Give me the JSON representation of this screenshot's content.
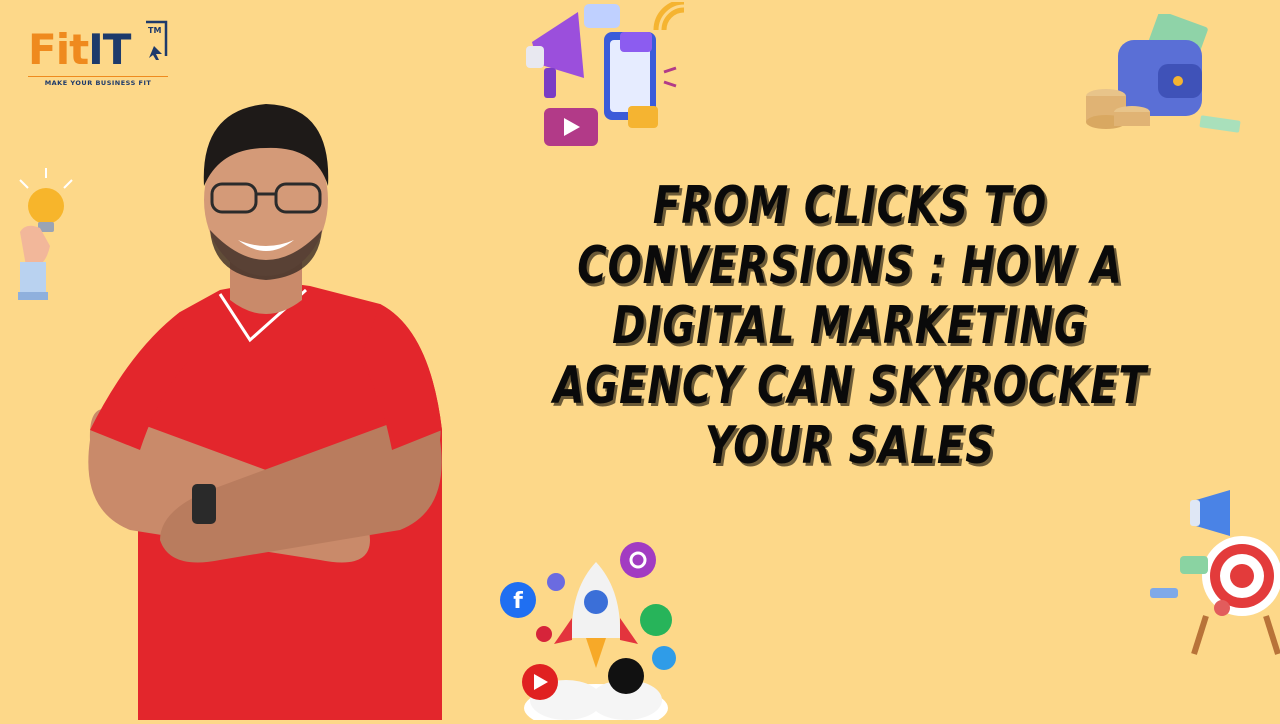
{
  "brand": {
    "logo_fit": "Fit",
    "logo_it": "IT",
    "trademark": "TM",
    "tagline": "MAKE YOUR BUSINESS FIT"
  },
  "headline": {
    "lines": [
      "FROM CLICKS TO",
      "CONVERSIONS : HOW A",
      "DIGITAL MARKETING",
      "AGENCY CAN SKYROCKET",
      "YOUR SALES"
    ]
  },
  "colors": {
    "background": "#fdd889",
    "shirt": "#e3262c",
    "brand_orange": "#ef8a1e",
    "brand_navy": "#1d3a6b",
    "headline": "#0a0a0a"
  },
  "icons": [
    "megaphone-phone-icon",
    "wallet-coins-icon",
    "lightbulb-hand-icon",
    "rocket-social-icon",
    "target-megaphone-icon"
  ]
}
